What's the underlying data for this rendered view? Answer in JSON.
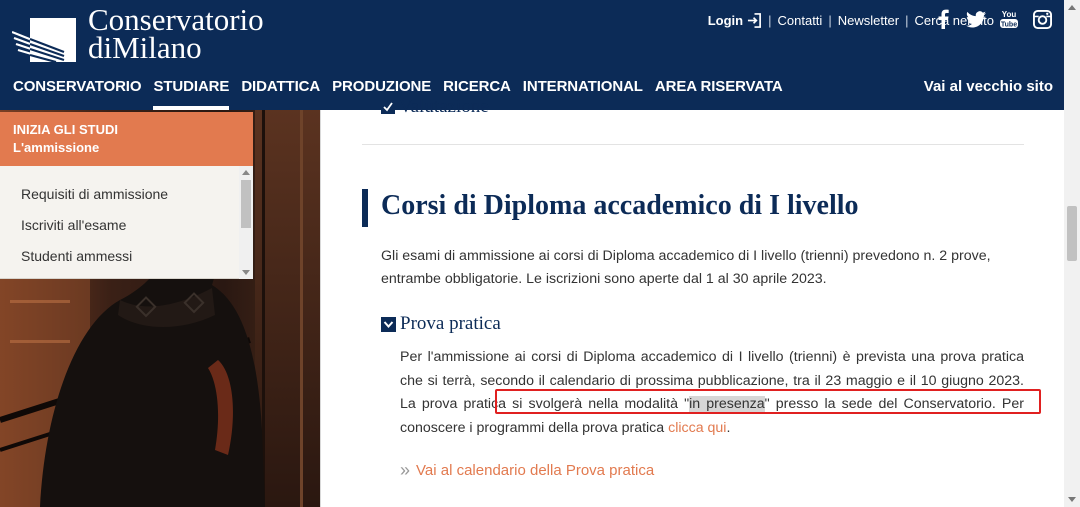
{
  "header": {
    "logo_line1": "Conservatorio",
    "logo_line2": "diMilano",
    "login_label": "Login",
    "utility_links": [
      "Contatti",
      "Newsletter",
      "Cerca nel sito"
    ],
    "social_icons": [
      "facebook-icon",
      "twitter-icon",
      "youtube-icon",
      "instagram-icon"
    ],
    "youtube_top": "You",
    "youtube_bottom": "Tube",
    "nav": [
      "CONSERVATORIO",
      "STUDIARE",
      "DIDATTICA",
      "PRODUZIONE",
      "RICERCA",
      "INTERNATIONAL",
      "AREA RISERVATA"
    ],
    "nav_active": "STUDIARE",
    "old_site_label": "Vai al vecchio sito",
    "bg_color": "#0c2b57"
  },
  "sidebar": {
    "section_label": "INIZIA GLI STUDI",
    "current_page": "L'ammissione",
    "items": [
      "Requisiti di ammissione",
      "Iscriviti all'esame",
      "Studenti ammessi"
    ],
    "accent_color": "#e27a4f"
  },
  "main": {
    "prev_accordion": "Valutazione",
    "section_title": "Corsi di Diploma accademico di I livello",
    "intro": "Gli esami di ammissione ai corsi di Diploma accademico di I livello (trienni) prevedono n. 2 prove, entrambe obbligatorie. Le iscrizioni sono aperte dal 1 al 30 aprile 2023.",
    "accordion_title": "Prova pratica",
    "body_part1": "Per l'ammissione ai corsi di Diploma accademico di I livello (trienni) è prevista una prova pratica che si terrà, secondo il calendario di prossima pubblicazione, tra il 23 maggio e il 10 giugno 2023. La prova pratica si svolgerà nella modalità \"",
    "body_highlight": "in presenza",
    "body_part2": "\" presso la sede del Conservatorio. Per conoscere i programmi della prova pratica ",
    "body_link": "clicca qui",
    "body_end": ".",
    "calendar_link": "Vai al calendario della Prova pratica",
    "calendar_arrow": "»"
  }
}
